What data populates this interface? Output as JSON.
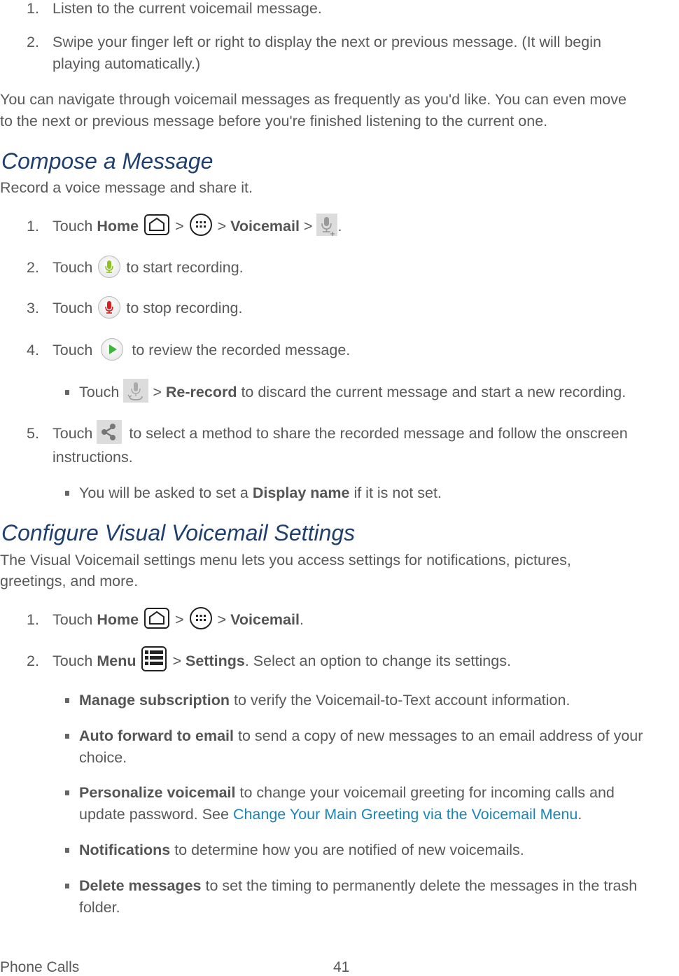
{
  "intro_steps": [
    {
      "num": "1.",
      "text": "Listen to the current voicemail message."
    },
    {
      "num": "2.",
      "text_line1": "Swipe your finger left or right to display the next or previous message. (It will begin",
      "text_line2": "playing automatically.)"
    }
  ],
  "intro_paragraph": {
    "line1": "You can navigate through voicemail messages as frequently as you'd like. You can even move",
    "line2": "to the next or previous message before you're finished listening to the current one."
  },
  "compose": {
    "heading": "Compose a Message",
    "description": "Record a voice message and share it.",
    "steps": [
      {
        "num": "1.",
        "touch": "Touch",
        "home": "Home",
        "sep": ">",
        "voicemail": "Voicemail",
        "end": "."
      },
      {
        "num": "2.",
        "touch": "Touch",
        "rest": "to start recording."
      },
      {
        "num": "3.",
        "touch": "Touch",
        "rest": "to stop recording."
      },
      {
        "num": "4.",
        "touch": "Touch",
        "rest": "to review the recorded message."
      },
      {
        "num": "5.",
        "touch": "Touch",
        "rest": "to select a method to share the recorded message and follow the onscreen",
        "rest_line2": "instructions."
      }
    ],
    "bullet_rerecord": {
      "touch": "Touch",
      "sep": ">",
      "bold": "Re-record",
      "rest": "to discard the current message and start a new recording."
    },
    "bullet_display_name": {
      "pre": "You will be asked to set a",
      "bold": "Display name",
      "rest": "if it is not set."
    }
  },
  "configure": {
    "heading": "Configure Visual Voicemail Settings",
    "description_line1": "The Visual Voicemail settings menu lets you access settings for notifications, pictures,",
    "description_line2": "greetings, and more.",
    "steps": [
      {
        "num": "1.",
        "touch": "Touch",
        "home": "Home",
        "sep": ">",
        "voicemail": "Voicemail",
        "end": "."
      },
      {
        "num": "2.",
        "touch": "Touch",
        "menu": "Menu",
        "sep": ">",
        "settings": "Settings",
        "rest": ". Select an option to change its settings."
      }
    ],
    "options": [
      {
        "bold": "Manage subscription",
        "rest": "to verify the Voicemail-to-Text account information."
      },
      {
        "bold": "Auto forward to email",
        "rest": "to send a copy of new messages to an email address of your",
        "rest_line2": "choice."
      },
      {
        "bold": "Personalize voicemail",
        "rest": "to change your voicemail greeting for incoming calls and",
        "line2_pre": "update password. See",
        "link": "Change Your Main Greeting via the Voicemail Menu",
        "line2_end": "."
      },
      {
        "bold": "Notifications",
        "rest": "to determine how you are notified of new voicemails."
      },
      {
        "bold": "Delete messages",
        "rest": "to set the timing to permanently delete the messages in the trash",
        "rest_line2": "folder."
      }
    ]
  },
  "footer": {
    "section": "Phone Calls",
    "page": "41"
  },
  "icons": {
    "home": "home-icon",
    "apps": "apps-icon",
    "new_voicemail": "mic-plus-icon",
    "record_start": "mic-green-icon",
    "record_stop": "mic-red-icon",
    "play": "play-icon",
    "rerecord": "mic-rerecord-icon",
    "share": "share-icon",
    "menu": "menu-icon"
  },
  "colors": {
    "heading": "#1f3f6e",
    "text": "#595959",
    "link": "#1b86b5",
    "record_green": "#8cc21e",
    "record_red": "#d61f1f",
    "play_green": "#3db53d"
  }
}
